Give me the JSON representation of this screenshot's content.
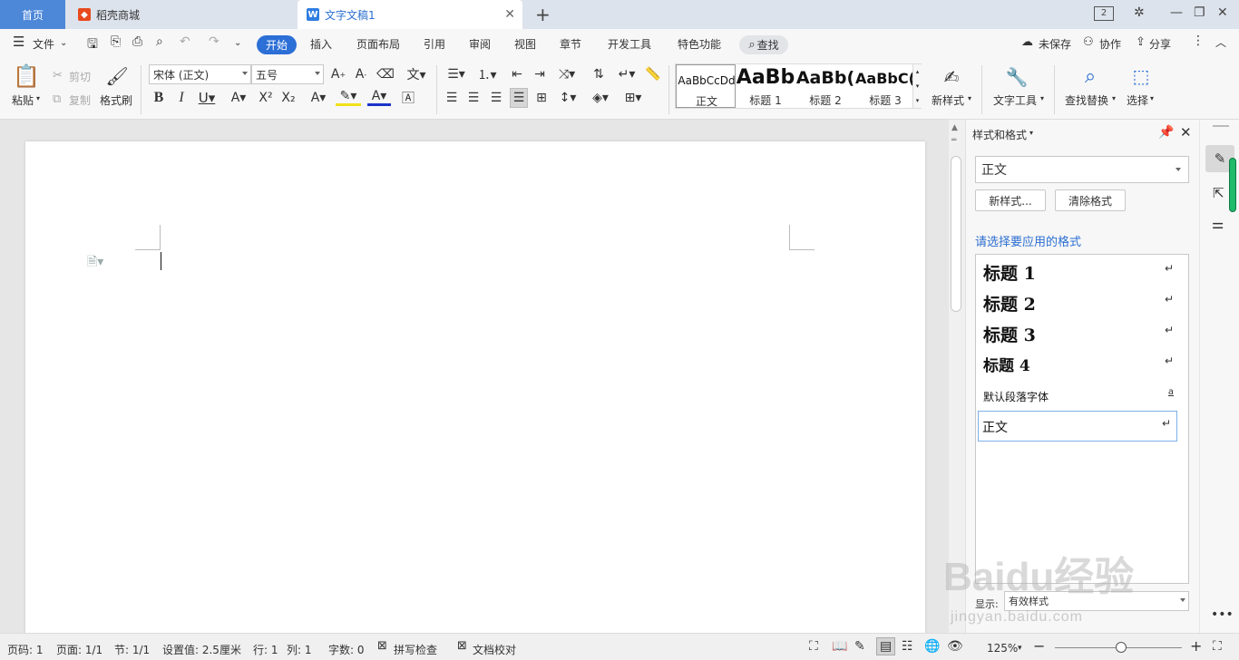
{
  "tabs": {
    "home": "首页",
    "store": "稻壳商城",
    "doc": "文字文稿1",
    "window_counter": "2"
  },
  "menu": {
    "file": "文件",
    "start": "开始",
    "insert": "插入",
    "layout": "页面布局",
    "reference": "引用",
    "review": "审阅",
    "view": "视图",
    "chapter": "章节",
    "dev": "开发工具",
    "special": "特色功能",
    "search": "查找",
    "unsaved": "未保存",
    "collab": "协作",
    "share": "分享"
  },
  "ribbon": {
    "paste": "粘贴",
    "cut": "剪切",
    "copy": "复制",
    "format_painter": "格式刷",
    "font_name": "宋体 (正文)",
    "font_size": "五号",
    "styles": [
      {
        "preview": "AaBbCcDd",
        "name": "正文"
      },
      {
        "preview": "AaBb",
        "name": "标题 1"
      },
      {
        "preview": "AaBb(",
        "name": "标题 2"
      },
      {
        "preview": "AaBbC(",
        "name": "标题 3"
      }
    ],
    "new_style": "新样式",
    "text_tools": "文字工具",
    "find_replace": "查找替换",
    "select": "选择"
  },
  "panel": {
    "title": "样式和格式",
    "current_style": "正文",
    "new_style_btn": "新样式...",
    "clear_format_btn": "清除格式",
    "prompt": "请选择要应用的格式",
    "styles": [
      {
        "name": "标题  1",
        "mark": "↵"
      },
      {
        "name": "标题  2",
        "mark": "↵"
      },
      {
        "name": "标题  3",
        "mark": "↵"
      },
      {
        "name": "标题  4",
        "mark": "↵"
      },
      {
        "name": "默认段落字体",
        "mark": "a"
      },
      {
        "name": "正文",
        "mark": "↵"
      }
    ],
    "show_label": "显示:",
    "show_value": "有效样式"
  },
  "status": {
    "page_num": "页码: 1",
    "pages": "页面: 1/1",
    "section": "节: 1/1",
    "setting": "设置值: 2.5厘米",
    "row": "行: 1",
    "col": "列: 1",
    "words": "字数: 0",
    "spell": "拼写检查",
    "proof": "文档校对",
    "zoom": "125%"
  },
  "watermark": {
    "brand": "Baidu经验",
    "url": "jingyan.baidu.com"
  },
  "colors": {
    "accent": "#2c6fd6",
    "home_tab": "#4c87d8",
    "store_icon": "#e8491d",
    "doc_icon": "#2f7de1",
    "panel_link": "#2b6ed1",
    "scroll_accent": "#1fba6a"
  }
}
